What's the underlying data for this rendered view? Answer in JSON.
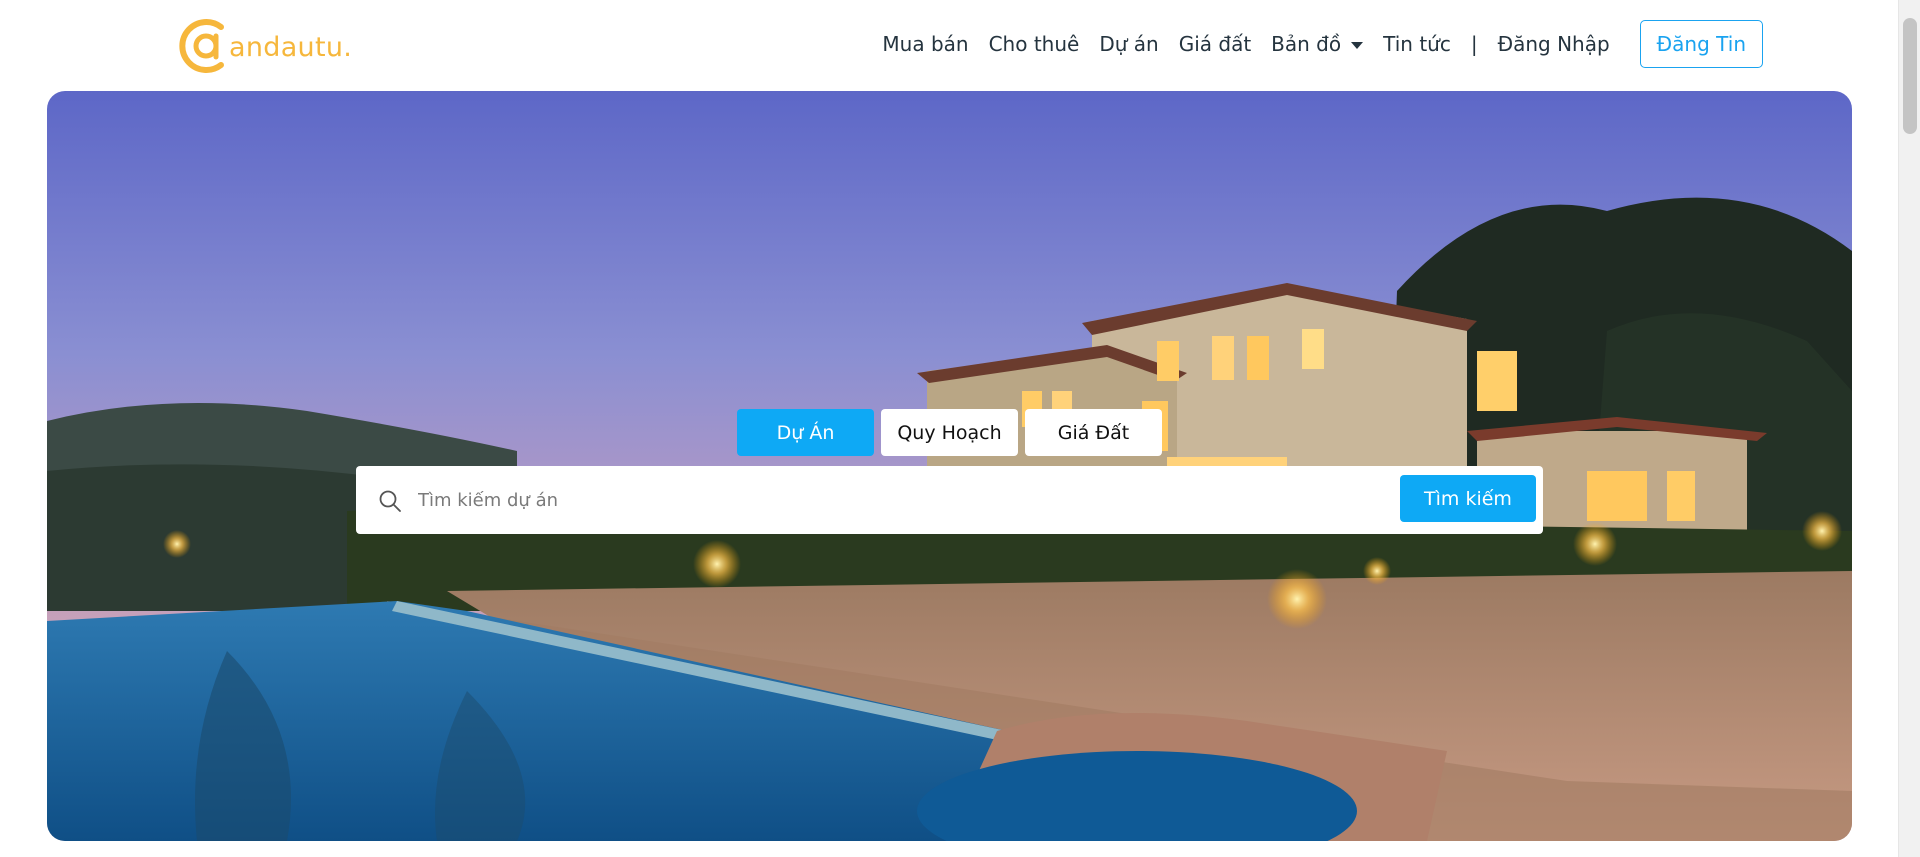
{
  "brand": {
    "logo_text": "andautu.",
    "color": "#f6b73c"
  },
  "nav": {
    "items": [
      {
        "label": "Mua bán"
      },
      {
        "label": "Cho thuê"
      },
      {
        "label": "Dự án"
      },
      {
        "label": "Giá đất"
      },
      {
        "label": "Bản đồ",
        "has_dropdown": true
      },
      {
        "label": "Tin tức"
      }
    ],
    "separator": "|",
    "login_label": "Đăng Nhập",
    "post_label": "Đăng Tin"
  },
  "search": {
    "tabs": [
      {
        "label": "Dự Án",
        "active": true
      },
      {
        "label": "Quy Hoạch",
        "active": false
      },
      {
        "label": "Giá Đất",
        "active": false
      }
    ],
    "placeholder": "Tìm kiếm dự án",
    "button_label": "Tìm kiếm"
  },
  "colors": {
    "accent": "#0ea9f5",
    "nav_text": "#25343f",
    "logo": "#f6b73c"
  },
  "icons": [
    "search-icon",
    "chevron-down-icon",
    "logo-icon"
  ]
}
